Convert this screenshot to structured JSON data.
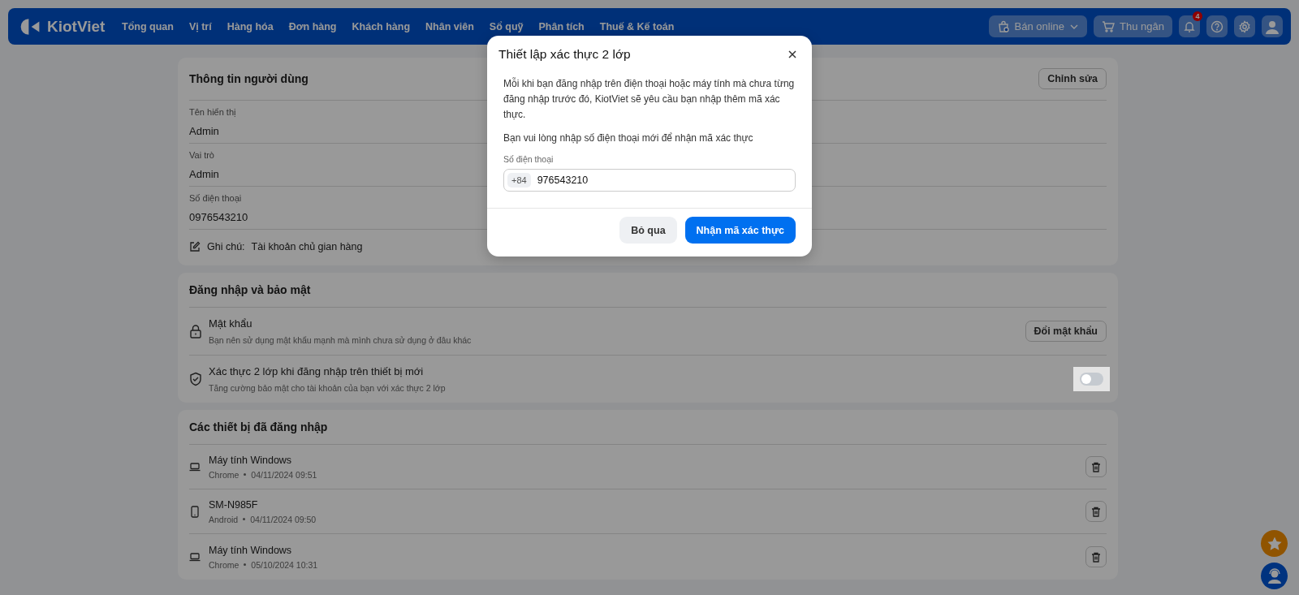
{
  "nav": {
    "logo": "KiotViet",
    "items": [
      "Tổng quan",
      "Vị trí",
      "Hàng hóa",
      "Đơn hàng",
      "Khách hàng",
      "Nhân viên",
      "Sổ quỹ",
      "Phân tích",
      "Thuế & Kế toán"
    ],
    "actions": [
      {
        "kind": "online",
        "label": "Bán online"
      },
      {
        "kind": "cashier",
        "label": "Thu ngân"
      }
    ],
    "notification_count": "4"
  },
  "user_info": {
    "title": "Thông tin người dùng",
    "edit_button": "Chỉnh sửa",
    "fields": [
      {
        "label": "Tên hiển thị",
        "value": "Admin"
      },
      {
        "label": "Vai trò",
        "value": "Admin"
      },
      {
        "label": "Số điện thoại",
        "value": "0976543210"
      }
    ],
    "note_label": "Ghi chú:",
    "note": "Tài khoản chủ gian hàng"
  },
  "security": {
    "title": "Đăng nhập và bảo mật",
    "items": [
      {
        "kind": "password",
        "title": "Mật khẩu",
        "description": "Bạn nên sử dụng mật khẩu mạnh mà mình chưa sử dụng ở đâu khác",
        "button": "Đổi mật khẩu"
      },
      {
        "kind": "two_factor",
        "title": "Xác thực 2 lớp khi đăng nhập trên thiết bị mới",
        "description": "Tăng cường bảo mật cho tài khoản của bạn với xác thực 2 lớp",
        "on": false
      }
    ]
  },
  "devices": {
    "title": "Các thiết bị đã đăng nhập",
    "items": [
      {
        "kind": "laptop",
        "name": "Máy tính Windows",
        "client": "Chrome",
        "time": "04/11/2024 09:51"
      },
      {
        "kind": "phone",
        "name": "SM-N985F",
        "client": "Android",
        "time": "04/11/2024 09:50"
      },
      {
        "kind": "laptop",
        "name": "Máy tính Windows",
        "client": "Chrome",
        "time": "05/10/2024 10:31"
      }
    ]
  },
  "modal": {
    "title": "Thiết lập xác thực 2 lớp",
    "paragraphs": [
      "Mỗi khi bạn đăng nhập trên điện thoại hoặc máy tính mà chưa từng đăng nhập trước đó, KiotViet sẽ yêu cầu bạn nhập thêm mã xác thực.",
      "Bạn vui lòng nhập số điện thoại mới để nhận mã xác thực"
    ],
    "field_label": "Số điện thoại",
    "country_code": "+84",
    "phone": "976543210",
    "buttons": [
      {
        "kind": "secondary",
        "label": "Bỏ qua"
      },
      {
        "kind": "primary",
        "label": "Nhận mã xác thực"
      }
    ]
  }
}
